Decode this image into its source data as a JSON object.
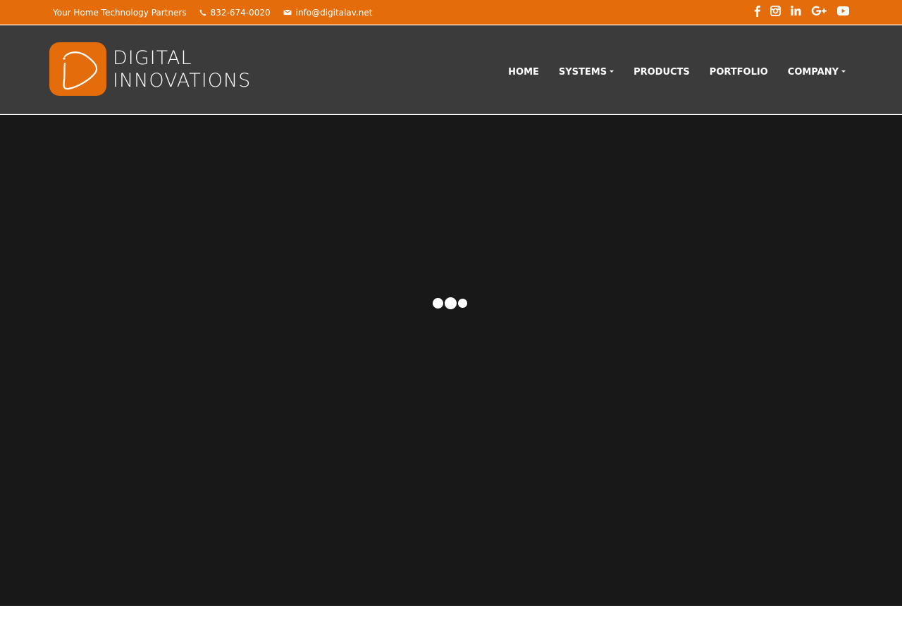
{
  "topbar": {
    "tagline": "Your Home Technology Partners",
    "phone": "832-674-0020",
    "email": "info@digitalav.net",
    "phone_icon": "phone-icon",
    "email_icon": "envelope-icon",
    "social": [
      {
        "icon": "facebook-icon"
      },
      {
        "icon": "instagram-icon"
      },
      {
        "icon": "linkedin-icon"
      },
      {
        "icon": "google-plus-icon"
      },
      {
        "icon": "youtube-icon"
      }
    ]
  },
  "header": {
    "logo": {
      "line1": "DIGITAL",
      "line2": "INNOVATIONS"
    },
    "nav": [
      {
        "label": "HOME",
        "has_dropdown": false
      },
      {
        "label": "SYSTEMS",
        "has_dropdown": true
      },
      {
        "label": "PRODUCTS",
        "has_dropdown": false
      },
      {
        "label": "PORTFOLIO",
        "has_dropdown": false
      },
      {
        "label": "COMPANY",
        "has_dropdown": true
      }
    ]
  },
  "colors": {
    "brand_orange": "#e46c0a",
    "header_bg": "#3b3b3b",
    "hero_bg": "#181818"
  },
  "loader": {
    "icon": "loading-dots-icon"
  }
}
